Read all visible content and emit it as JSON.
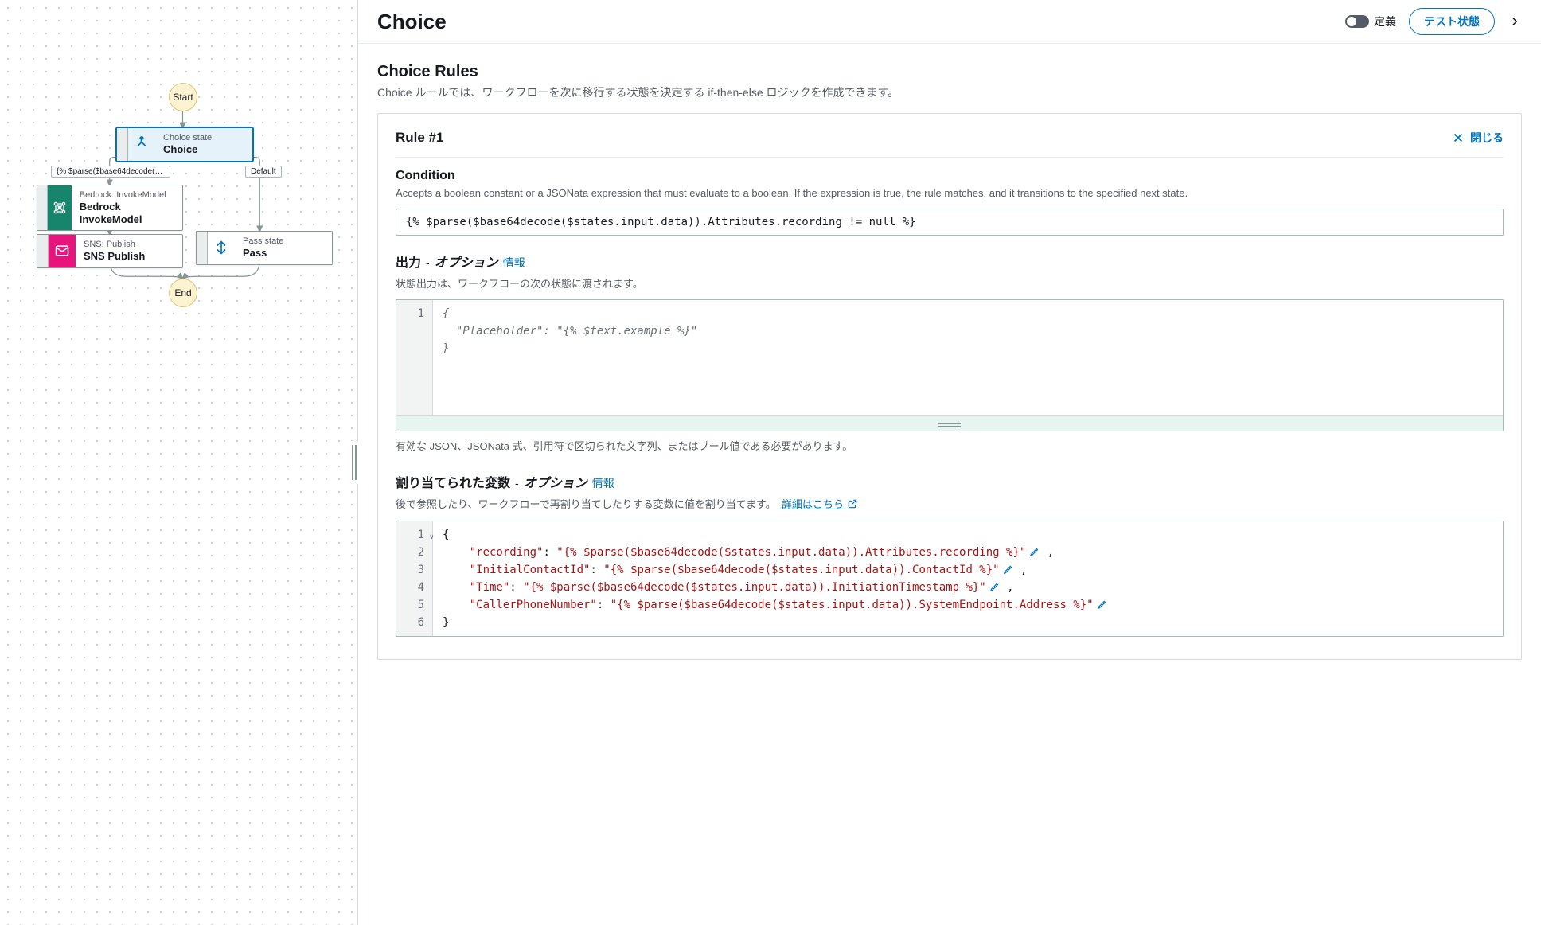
{
  "header": {
    "title": "Choice",
    "definition_toggle_label": "定義",
    "test_state_button": "テスト状態"
  },
  "graph": {
    "start": "Start",
    "end": "End",
    "nodes": {
      "choice": {
        "sup": "Choice state",
        "title": "Choice"
      },
      "bedrock": {
        "sup": "Bedrock: InvokeModel",
        "title": "Bedrock InvokeModel"
      },
      "sns": {
        "sup": "SNS: Publish",
        "title": "SNS Publish"
      },
      "pass": {
        "sup": "Pass state",
        "title": "Pass"
      }
    },
    "edge_labels": {
      "rule1": "{% $parse($base64decode($states.input...",
      "default": "Default"
    }
  },
  "rules": {
    "section_title": "Choice Rules",
    "section_desc": "Choice ルールでは、ワークフローを次に移行する状態を決定する if-then-else ロジックを作成できます。",
    "rule1": {
      "title": "Rule #1",
      "close_label": "閉じる",
      "condition": {
        "title": "Condition",
        "desc": "Accepts a boolean constant or a JSONata expression that must evaluate to a boolean. If the expression is true, the rule matches, and it transitions to the specified next state.",
        "value": "{% $parse($base64decode($states.input.data)).Attributes.recording != null %}"
      },
      "output": {
        "title": "出力",
        "option_label": "オプション",
        "info_link": "情報",
        "desc": "状態出力は、ワークフローの次の状態に渡されます。",
        "placeholder_lines": [
          "{",
          "  \"Placeholder\": \"{% $text.example %}\"",
          "}"
        ],
        "helper": "有効な JSON、JSONata 式、引用符で区切られた文字列、またはブール値である必要があります。"
      },
      "assigned_vars": {
        "title": "割り当てられた変数",
        "option_label": "オプション",
        "info_link": "情報",
        "desc": "後で参照したり、ワークフローで再割り当てしたりする変数に値を割り当てます。",
        "learn_more": "詳細はこちら",
        "entries": [
          {
            "key": "recording",
            "value": "{% $parse($base64decode($states.input.data)).Attributes.recording %}"
          },
          {
            "key": "InitialContactId",
            "value": "{% $parse($base64decode($states.input.data)).ContactId %}"
          },
          {
            "key": "Time",
            "value": "{% $parse($base64decode($states.input.data)).InitiationTimestamp %}"
          },
          {
            "key": "CallerPhoneNumber",
            "value": "{% $parse($base64decode($states.input.data)).SystemEndpoint.Address %}"
          }
        ]
      }
    }
  }
}
